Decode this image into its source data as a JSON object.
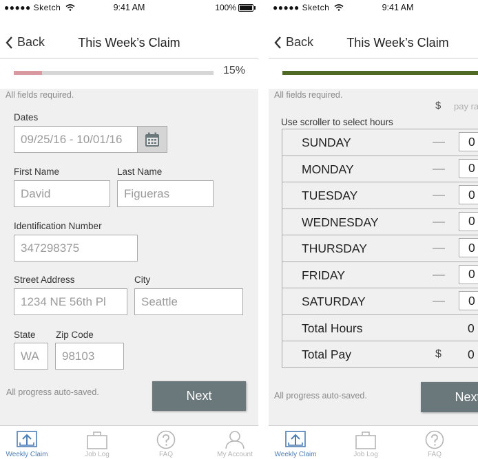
{
  "status": {
    "carrier": "●●●●● Sketch",
    "time": "9:41 AM",
    "battery": "100%"
  },
  "screen1": {
    "nav": {
      "back": "Back",
      "title": "This Week’s Claim"
    },
    "progress": {
      "value": 0.14,
      "label": "15%"
    },
    "required_note": "All fields required.",
    "dates": {
      "label": "Dates",
      "value": "09/25/16 - 10/01/16"
    },
    "first_name": {
      "label": "First Name",
      "value": "David"
    },
    "last_name": {
      "label": "Last Name",
      "value": "Figueras"
    },
    "id_number": {
      "label": "Identification Number",
      "value": "347298375"
    },
    "street": {
      "label": "Street Address",
      "value": "1234 NE 56th Pl"
    },
    "city": {
      "label": "City",
      "value": "Seattle"
    },
    "state": {
      "label": "State",
      "value": "WA"
    },
    "zip": {
      "label": "Zip Code",
      "value": "98103"
    },
    "autosave": "All progress auto-saved.",
    "next": "Next"
  },
  "screen2": {
    "nav": {
      "back": "Back",
      "title": "This Week’s Claim"
    },
    "progress": {
      "value": 0.81
    },
    "required_note": "All fields required.",
    "rate": {
      "currency": "$",
      "placeholder": "pay rate"
    },
    "scroller_hint": "Use scroller to select hours",
    "days": [
      {
        "name": "SUNDAY",
        "hours": "0"
      },
      {
        "name": "MONDAY",
        "hours": "0"
      },
      {
        "name": "TUESDAY",
        "hours": "0"
      },
      {
        "name": "WEDNESDAY",
        "hours": "0"
      },
      {
        "name": "THURSDAY",
        "hours": "0"
      },
      {
        "name": "FRIDAY",
        "hours": "0"
      },
      {
        "name": "SATURDAY",
        "hours": "0"
      }
    ],
    "total_hours": {
      "label": "Total Hours",
      "value": "0"
    },
    "total_pay": {
      "label": "Total Pay",
      "currency": "$",
      "value": "0"
    },
    "autosave": "All progress auto-saved.",
    "next": "Next"
  },
  "tabs": [
    {
      "label": "Weekly Claim",
      "icon": "upload-tray-icon",
      "active": true
    },
    {
      "label": "Job Log",
      "icon": "briefcase-icon",
      "active": false
    },
    {
      "label": "FAQ",
      "icon": "question-circle-icon",
      "active": false
    },
    {
      "label": "My Account",
      "icon": "person-icon",
      "active": false
    }
  ],
  "colors": {
    "accent": "#4d7db5",
    "progress_1": "#d89aa0",
    "progress_2": "#4e6a25",
    "button": "#6a787c"
  }
}
